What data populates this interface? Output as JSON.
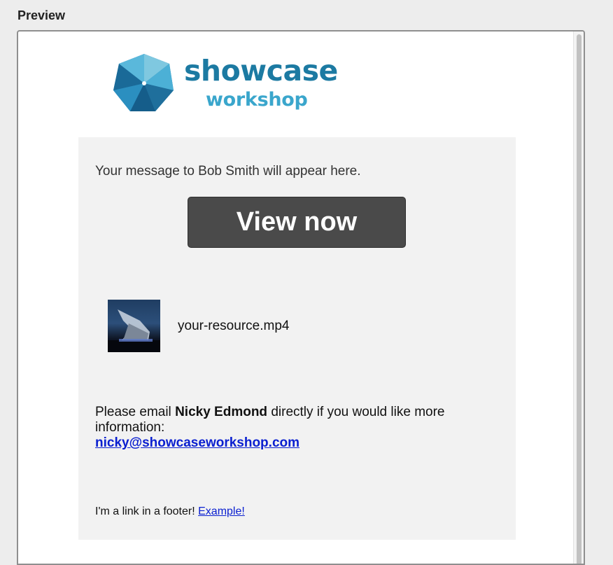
{
  "preview": {
    "heading": "Preview"
  },
  "logo": {
    "line1": "showcase",
    "line2": "workshop",
    "colors": {
      "dark": "#1c7aa2",
      "light": "#3aa6cc"
    }
  },
  "email": {
    "message": "Your message to Bob Smith will appear here.",
    "button_label": "View now",
    "resource_name": "your-resource.mp4",
    "info_prefix": "Please email ",
    "contact_name": "Nicky Edmond",
    "info_suffix": " directly if you would like more information:",
    "contact_email": "nicky@showcaseworkshop.com",
    "footer_text": "I'm a link in a footer! ",
    "footer_link": "Example!"
  },
  "icons": {
    "thumbnail": "video-thumbnail-icon",
    "logo": "showcase-logo-icon"
  }
}
